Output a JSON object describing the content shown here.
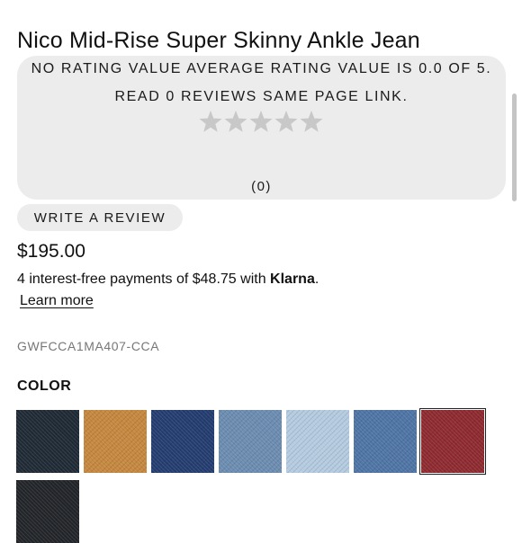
{
  "product": {
    "title": "Nico Mid-Rise Super Skinny Ankle Jean",
    "price": "$195.00",
    "sku": "GWFCCA1MA407-CCA"
  },
  "rating": {
    "summary_line1": "NO RATING VALUE AVERAGE RATING VALUE IS 0.0 OF 5.",
    "summary_line2": "READ 0 REVIEWS SAME PAGE LINK.",
    "stars_filled": 0,
    "stars_total": 5,
    "star_color": "#c8c8c8",
    "review_count": "(0)",
    "write_review_label": "WRITE A REVIEW"
  },
  "payment": {
    "text_before": "4 interest-free payments of $48.75 with ",
    "brand": "Klarna",
    "text_after": ".",
    "learn_more": "Learn more"
  },
  "color_section": {
    "label": "COLOR",
    "swatches": [
      {
        "name": "dark-wash-black-blue",
        "color": "#1f2a36",
        "selected": false
      },
      {
        "name": "tan",
        "color": "#c6883f",
        "selected": false
      },
      {
        "name": "deep-indigo",
        "color": "#243d70",
        "selected": false
      },
      {
        "name": "medium-blue-wash",
        "color": "#6c8db1",
        "selected": false
      },
      {
        "name": "light-blue-wash",
        "color": "#b4cbe0",
        "selected": false
      },
      {
        "name": "mid-blue",
        "color": "#4f75a6",
        "selected": false
      },
      {
        "name": "burgundy",
        "color": "#8e2a30",
        "selected": true
      },
      {
        "name": "black",
        "color": "#222529",
        "selected": false
      }
    ]
  }
}
